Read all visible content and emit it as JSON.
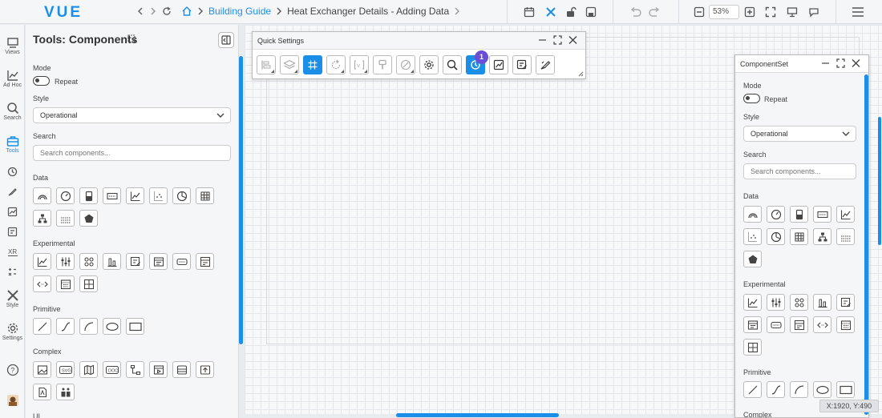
{
  "app": {
    "logo": "VUE"
  },
  "breadcrumb": {
    "items": [
      "Building Guide",
      "Heat Exchanger Details - Adding Data"
    ]
  },
  "toolbar": {
    "zoom": "53%"
  },
  "rail": {
    "items": [
      "Views",
      "Ad Hoc",
      "Search",
      "Tools",
      "Style",
      "Settings"
    ]
  },
  "tools_panel": {
    "title": "Tools: Components",
    "mode_label": "Mode",
    "repeat_label": "Repeat",
    "style_label": "Style",
    "style_value": "Operational",
    "search_label": "Search",
    "search_placeholder": "Search components...",
    "sections": {
      "data": "Data",
      "experimental": "Experimental",
      "primitive": "Primitive",
      "complex": "Complex",
      "ui": "UI"
    }
  },
  "quick_settings": {
    "title": "Quick Settings",
    "badge": "1"
  },
  "component_set": {
    "title": "ComponentSet",
    "mode_label": "Mode",
    "repeat_label": "Repeat",
    "style_label": "Style",
    "style_value": "Operational",
    "search_label": "Search",
    "search_placeholder": "Search components...",
    "sections": {
      "data": "Data",
      "experimental": "Experimental",
      "primitive": "Primitive",
      "complex": "Complex"
    }
  },
  "status": {
    "coords": "X:1920, Y:490"
  },
  "colors": {
    "accent": "#1b8fe8",
    "badge": "#6a4fd6"
  }
}
